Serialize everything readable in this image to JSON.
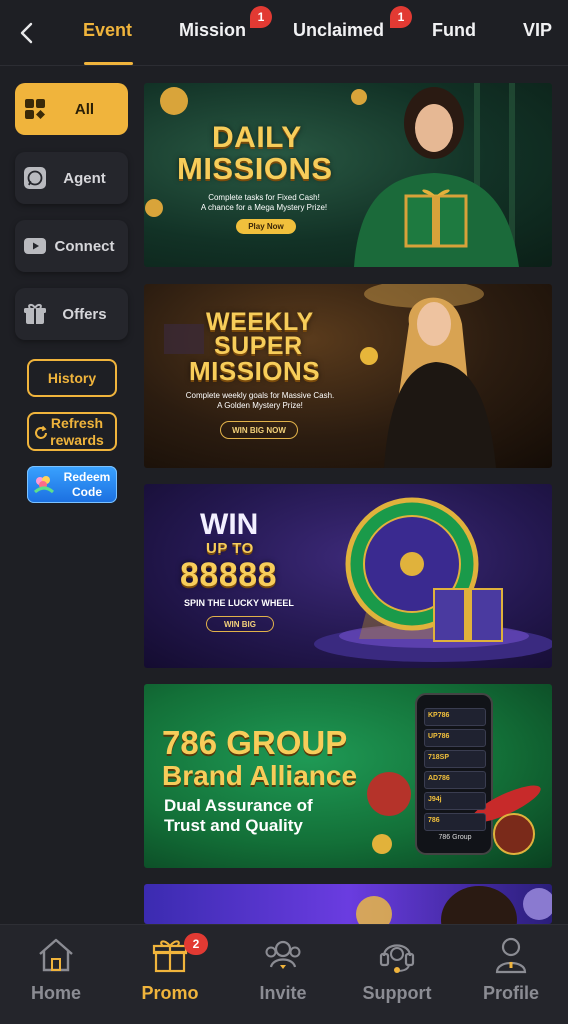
{
  "tabs": [
    {
      "label": "Event",
      "active": true,
      "badge": ""
    },
    {
      "label": "Mission",
      "active": false,
      "badge": "1"
    },
    {
      "label": "Unclaimed",
      "active": false,
      "badge": "1"
    },
    {
      "label": "Fund",
      "active": false,
      "badge": ""
    },
    {
      "label": "VIP",
      "active": false,
      "badge": ""
    }
  ],
  "sidebar": {
    "items": [
      {
        "label": "All",
        "icon": "grid-icon",
        "active": true
      },
      {
        "label": "Agent",
        "icon": "whatsapp-icon",
        "active": false
      },
      {
        "label": "Connect",
        "icon": "youtube-icon",
        "active": false
      },
      {
        "label": "Offers",
        "icon": "gift-icon",
        "active": false
      }
    ],
    "history_label": "History",
    "refresh_label_line1": "Refresh",
    "refresh_label_line2": "rewards",
    "redeem_label_line1": "Redeem",
    "redeem_label_line2": "Code"
  },
  "banners": {
    "daily": {
      "title1": "DAILY",
      "title2": "MISSIONS",
      "sub1": "Complete tasks for Fixed Cash!",
      "sub2": "A chance for a Mega Mystery Prize!",
      "cta": "Play Now"
    },
    "weekly": {
      "title1": "WEEKLY",
      "title2": "SUPER",
      "title3": "MISSIONS",
      "sub1": "Complete weekly goals for Massive Cash.",
      "sub2": "A Golden Mystery Prize!",
      "cta": "WIN BIG NOW"
    },
    "wheel": {
      "title1": "WIN",
      "title2": "UP TO",
      "amount": "88888",
      "sub": "SPIN THE LUCKY WHEEL",
      "cta": "WIN BIG"
    },
    "group": {
      "title1": "786 GROUP",
      "title2": "Brand Alliance",
      "sub1": "Dual Assurance of",
      "sub2": "Trust and Quality",
      "phone_label": "786 Group",
      "phone_items": [
        "KP786",
        "UP786",
        "718SP",
        "AD786",
        "J94j",
        "786"
      ]
    }
  },
  "bottom_nav": [
    {
      "label": "Home",
      "icon": "home-icon",
      "active": false,
      "badge": ""
    },
    {
      "label": "Promo",
      "icon": "gift-icon",
      "active": true,
      "badge": "2"
    },
    {
      "label": "Invite",
      "icon": "invite-icon",
      "active": false,
      "badge": ""
    },
    {
      "label": "Support",
      "icon": "headset-icon",
      "active": false,
      "badge": ""
    },
    {
      "label": "Profile",
      "icon": "profile-icon",
      "active": false,
      "badge": ""
    }
  ],
  "colors": {
    "accent": "#f0b43c",
    "background": "#1e1f24",
    "badge": "#e23a33"
  }
}
